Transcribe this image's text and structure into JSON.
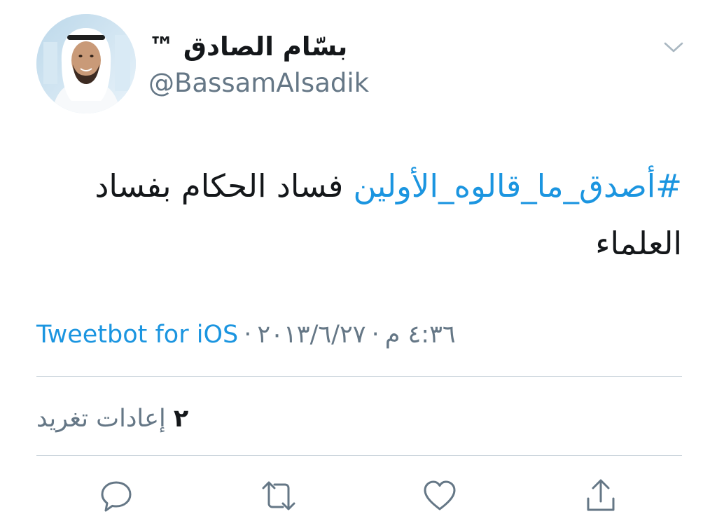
{
  "tweet": {
    "author": {
      "display_name": "بسّام الصادق ™",
      "username": "@BassamAlsadik"
    },
    "text": {
      "hashtag": "#أصدق_ما_قالوه_الأولين",
      "body": " فساد الحكام بفساد العلماء"
    },
    "meta": {
      "time": "٤:٣٦ م",
      "date": "٢٠١٣/٦/٢٧",
      "separator": "·",
      "source": "Tweetbot for iOS"
    },
    "stats": {
      "retweet_count": "٢",
      "retweet_label": "إعادات تغريد"
    }
  },
  "icons": {
    "chevron": "chevron-down-icon",
    "reply": "reply-icon",
    "retweet": "retweet-icon",
    "like": "heart-icon",
    "share": "share-icon"
  },
  "colors": {
    "link": "#1b95e0",
    "secondary_text": "#657786",
    "primary_text": "#14171a",
    "divider": "#ccd6dd"
  }
}
